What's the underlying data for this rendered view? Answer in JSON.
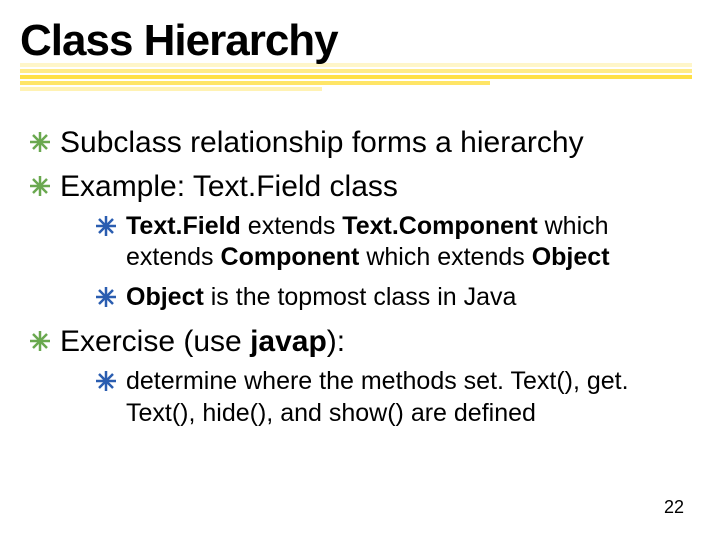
{
  "title": "Class Hierarchy",
  "bullets": {
    "item0": {
      "text": "Subclass relationship forms a hierarchy"
    },
    "item1": {
      "text": "Example:  Text.Field class",
      "sub0": {
        "segs": {
          "s0": "Text.Field",
          "s1": " extends ",
          "s2": "Text.Component",
          "s3": " which extends ",
          "s4": "Component",
          "s5": " which extends ",
          "s6": "Object"
        }
      },
      "sub1": {
        "segs": {
          "s0": "Object",
          "s1": " is the topmost class in Java"
        }
      }
    },
    "item2": {
      "segs": {
        "s0": "Exercise (use ",
        "s1": "javap",
        "s2": "):"
      },
      "sub0": {
        "text": "determine where the methods set. Text(), get. Text(), hide(), and show() are defined"
      }
    }
  },
  "page_number": "22"
}
